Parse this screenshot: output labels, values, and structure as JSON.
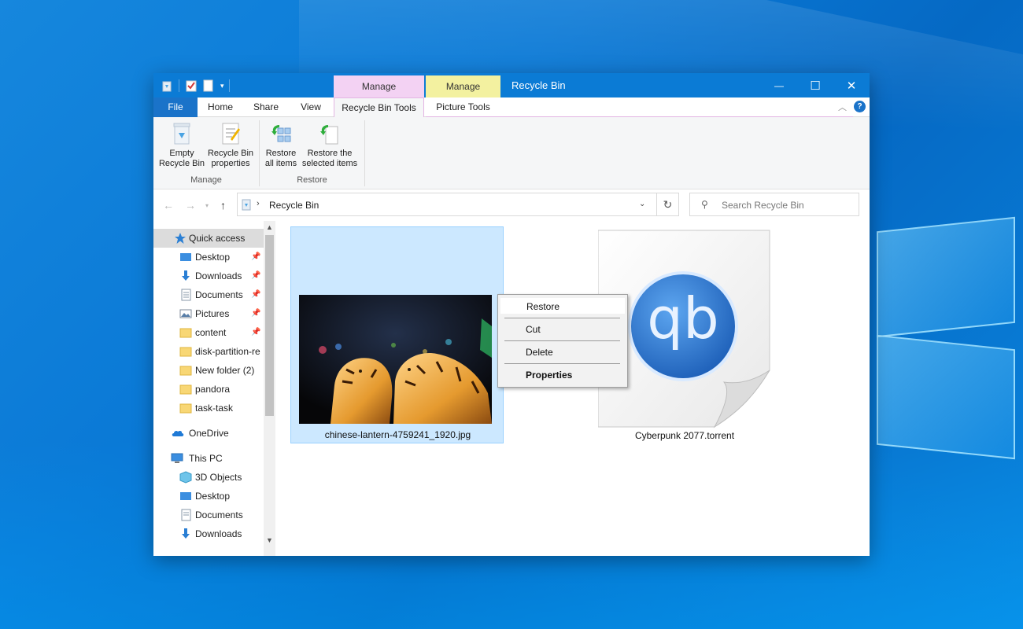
{
  "colors": {
    "titlebar": "#0b7bd5",
    "file_tab": "#1a73c9",
    "manage_tab_recycle": "#f3d2f3",
    "manage_tab_picture": "#f3f1a0",
    "selection": "#cce8ff",
    "context_menu": "#f2f2f2"
  },
  "titlebar": {
    "title": "Recycle Bin",
    "contextual_tabs": [
      "Manage",
      "Manage"
    ],
    "quick_access_icons": [
      "recycle-bin-icon",
      "properties-check-icon",
      "new-folder-icon",
      "customize-dropdown-icon"
    ],
    "controls": {
      "minimize": "—",
      "maximize": "☐",
      "close": "✕"
    }
  },
  "tabs": {
    "file": "File",
    "home": "Home",
    "share": "Share",
    "view": "View",
    "recycle_bin_tools": "Recycle Bin Tools",
    "picture_tools": "Picture Tools"
  },
  "ribbon": {
    "empty_recycle_bin": "Empty Recycle Bin",
    "empty_line1": "Empty",
    "empty_line2": "Recycle Bin",
    "properties_line1": "Recycle Bin",
    "properties_line2": "properties",
    "restore_all_line1": "Restore",
    "restore_all_line2": "all items",
    "restore_sel_line1": "Restore the",
    "restore_sel_line2": "selected items",
    "group_manage": "Manage",
    "group_restore": "Restore"
  },
  "address": {
    "path": "Recycle Bin",
    "search_placeholder": "Search Recycle Bin"
  },
  "nav": {
    "quick_access": "Quick access",
    "items": [
      {
        "label": "Desktop",
        "icon": "desktop-icon",
        "pinned": true
      },
      {
        "label": "Downloads",
        "icon": "downloads-icon",
        "pinned": true
      },
      {
        "label": "Documents",
        "icon": "documents-icon",
        "pinned": true
      },
      {
        "label": "Pictures",
        "icon": "pictures-icon",
        "pinned": true
      },
      {
        "label": "content",
        "icon": "folder-icon",
        "pinned": true
      },
      {
        "label": "disk-partition-re",
        "icon": "folder-icon",
        "pinned": false
      },
      {
        "label": "New folder (2)",
        "icon": "folder-icon",
        "pinned": false
      },
      {
        "label": "pandora",
        "icon": "folder-icon",
        "pinned": false
      },
      {
        "label": "task-task",
        "icon": "folder-icon",
        "pinned": false
      }
    ],
    "onedrive": "OneDrive",
    "this_pc": "This PC",
    "pc_items": [
      {
        "label": "3D Objects",
        "icon": "3d-objects-icon"
      },
      {
        "label": "Desktop",
        "icon": "desktop-icon"
      },
      {
        "label": "Documents",
        "icon": "documents-icon"
      },
      {
        "label": "Downloads",
        "icon": "downloads-icon"
      }
    ]
  },
  "files": [
    {
      "name": "chinese-lantern-4759241_1920.jpg",
      "selected": true,
      "type": "image"
    },
    {
      "name": "Cyberpunk 2077.torrent",
      "selected": false,
      "type": "torrent"
    }
  ],
  "torrent_logo": "qb",
  "context_menu": {
    "items": [
      "Restore",
      "Cut",
      "Delete",
      "Properties"
    ],
    "hovered": "Restore",
    "default": "Properties"
  }
}
